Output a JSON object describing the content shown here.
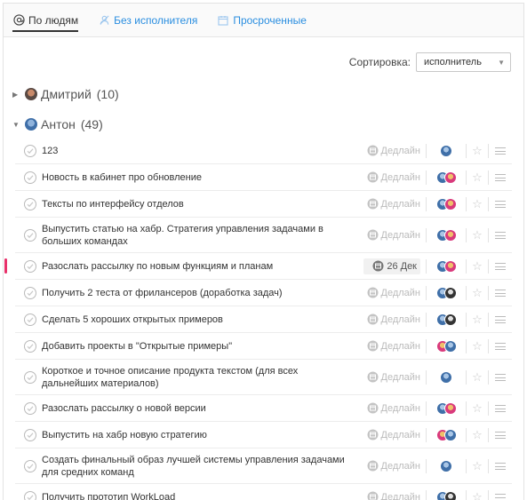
{
  "tabs": [
    {
      "label": "По людям",
      "icon": "at-icon"
    },
    {
      "label": "Без исполнителя",
      "icon": "person-off-icon"
    },
    {
      "label": "Просроченные",
      "icon": "calendar-icon"
    }
  ],
  "sort": {
    "label": "Сортировка:",
    "value": "исполнитель"
  },
  "groups": [
    {
      "name": "Дмитрий",
      "count": "(10)",
      "expanded": false
    },
    {
      "name": "Антон",
      "count": "(49)",
      "expanded": true
    }
  ],
  "tasks": [
    {
      "title": "123",
      "deadline": "Дедлайн"
    },
    {
      "title": "Новость в кабинет про обновление",
      "deadline": "Дедлайн"
    },
    {
      "title": "Тексты по интерфейсу отделов",
      "deadline": "Дедлайн"
    },
    {
      "title": "Выпустить статью на хабр. Стратегия управления задачами в больших командах",
      "deadline": "Дедлайн"
    },
    {
      "title": "Разослать рассылку по новым функциям и планам",
      "deadline": "26 Дек"
    },
    {
      "title": "Получить 2 теста от фрилансеров (доработка задач)",
      "deadline": "Дедлайн"
    },
    {
      "title": "Сделать 5 хороших открытых примеров",
      "deadline": "Дедлайн"
    },
    {
      "title": "Добавить проекты в \"Открытые примеры\"",
      "deadline": "Дедлайн"
    },
    {
      "title": "Короткое и точное описание продукта текстом (для всех дальнейших материалов)",
      "deadline": "Дедлайн"
    },
    {
      "title": "Разослать рассылку о новой версии",
      "deadline": "Дедлайн"
    },
    {
      "title": "Выпустить на хабр новую стратегию",
      "deadline": "Дедлайн"
    },
    {
      "title": "Создать финальный образ лучшей системы управления задачами для средних команд",
      "deadline": "Дедлайн"
    },
    {
      "title": "Получить прототип WorkLoad",
      "deadline": "Дедлайн"
    }
  ],
  "colors": {
    "accent": "#2a8ee0",
    "highlight": "#e8306a",
    "avatar_blue": "#3f6fa8",
    "avatar_pink": "#d93a7c",
    "avatar_dark": "#333333"
  },
  "icons": {
    "check": "check-icon",
    "calendar": "calendar-icon",
    "star": "star-icon",
    "menu": "menu-icon",
    "triangle_right": "triangle-right-icon",
    "triangle_down": "triangle-down-icon"
  }
}
